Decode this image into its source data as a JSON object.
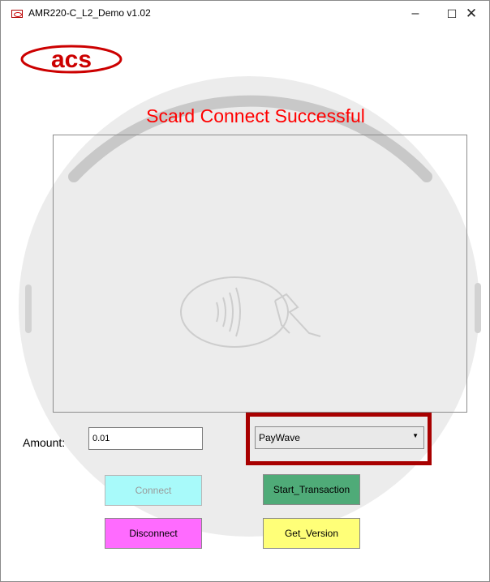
{
  "window": {
    "title": "AMR220-C_L2_Demo v1.02",
    "minimize_glyph": "–",
    "maximize_glyph": "☐",
    "close_glyph": "✕"
  },
  "logo": {
    "text": "acs"
  },
  "status": {
    "message": "Scard Connect Successful",
    "color": "#ff0000"
  },
  "amount": {
    "label": "Amount:",
    "value": "0.01"
  },
  "card_type": {
    "selected": "PayWave",
    "highlight_color": "#a80000"
  },
  "buttons": {
    "connect": "Connect",
    "start_transaction": "Start_Transaction",
    "disconnect": "Disconnect",
    "get_version": "Get_Version"
  },
  "icons": {
    "app": "acs-app-icon",
    "contactless": "contactless-tap-icon",
    "dropdown": "chevron-down-icon"
  }
}
